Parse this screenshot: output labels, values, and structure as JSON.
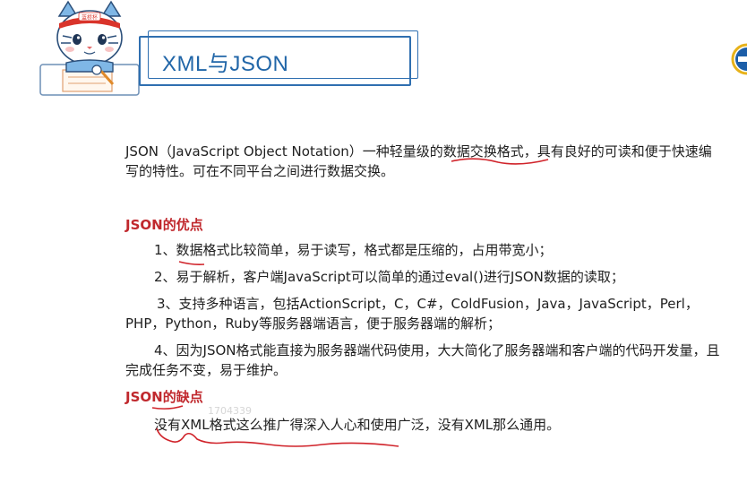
{
  "slide": {
    "title": "XML与JSON",
    "intro": "JSON（JavaScript Object Notation）一种轻量级的数据交换格式，具有良好的可读和便于快速编写的特性。可在不同平台之间进行数据交换。",
    "pros_title": "JSON的优点",
    "pros": [
      "1、数据格式比较简单，易于读写，格式都是压缩的，占用带宽小；",
      "2、易于解析，客户端JavaScript可以简单的通过eval()进行JSON数据的读取；",
      "3、支持多种语言，包括ActionScript，C，C#，ColdFusion，Java，JavaScript，Perl，PHP，Python，Ruby等服务器端语言，便于服务器端的解析；",
      "4、因为JSON格式能直接为服务器端代码使用，大大简化了服务器端和客户端的代码开发量，且完成任务不变，易于维护。"
    ],
    "cons_title": "JSON的缺点",
    "cons": "没有XML格式这么推广得深入人心和使用广泛，没有XML那么通用。",
    "watermark": "1704339",
    "mascot_badge": "蓝桥杯"
  },
  "colors": {
    "accent_blue": "#2f6fb0",
    "section_red": "#c0282d",
    "ink_red": "#d0232a"
  },
  "icons": [
    "tiger-mascot-icon",
    "corner-logo-icon"
  ]
}
